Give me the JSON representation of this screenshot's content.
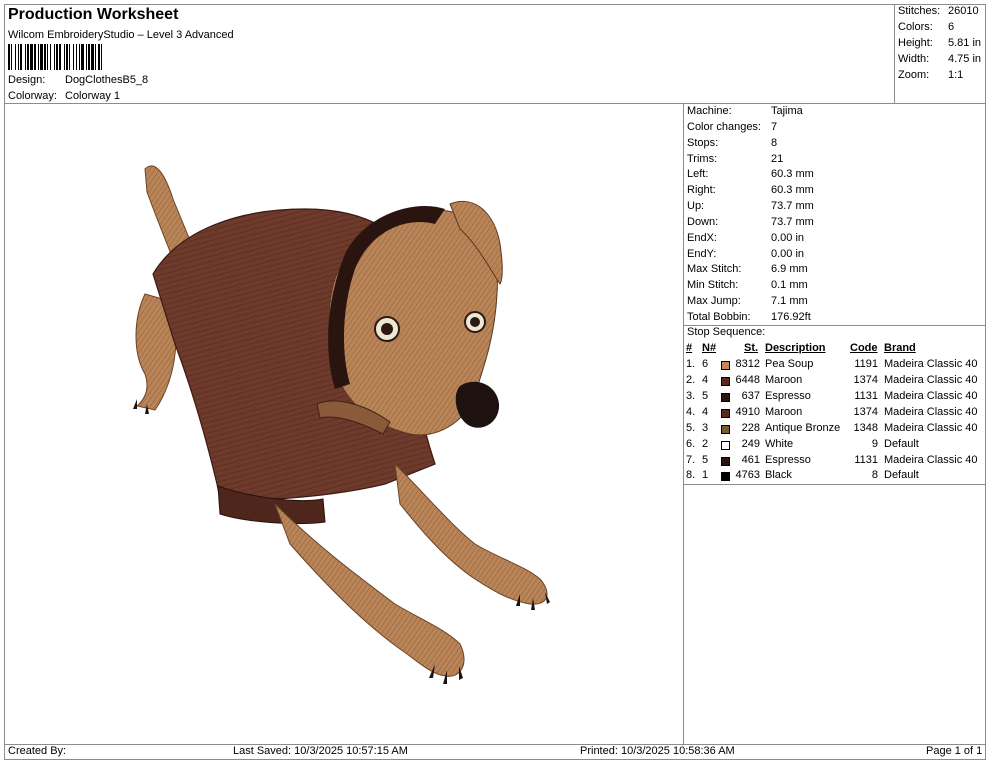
{
  "header": {
    "title": "Production Worksheet",
    "software": "Wilcom EmbroideryStudio – Level 3 Advanced",
    "design_label": "Design:",
    "design_value": "DogClothesB5_8",
    "colorway_label": "Colorway:",
    "colorway_value": "Colorway 1"
  },
  "summary": [
    {
      "label": "Stitches:",
      "value": "26010"
    },
    {
      "label": "Colors:",
      "value": "6"
    },
    {
      "label": "Height:",
      "value": "5.81 in"
    },
    {
      "label": "Width:",
      "value": "4.75 in"
    },
    {
      "label": "Zoom:",
      "value": "1:1"
    }
  ],
  "machine_info": [
    {
      "label": "Machine:",
      "value": "Tajima"
    },
    {
      "label": "Color changes:",
      "value": "7"
    },
    {
      "label": "Stops:",
      "value": "8"
    },
    {
      "label": "Trims:",
      "value": "21"
    },
    {
      "label": "Left:",
      "value": "60.3 mm"
    },
    {
      "label": "Right:",
      "value": "60.3 mm"
    },
    {
      "label": "Up:",
      "value": "73.7 mm"
    },
    {
      "label": "Down:",
      "value": "73.7 mm"
    },
    {
      "label": "EndX:",
      "value": "0.00 in"
    },
    {
      "label": "EndY:",
      "value": "0.00 in"
    },
    {
      "label": "Max Stitch:",
      "value": "6.9 mm"
    },
    {
      "label": "Min Stitch:",
      "value": "0.1 mm"
    },
    {
      "label": "Max Jump:",
      "value": "7.1 mm"
    },
    {
      "label": "Total Bobbin:",
      "value": "176.92ft"
    }
  ],
  "stop_sequence": {
    "title": "Stop Sequence:",
    "columns": {
      "num": "#",
      "n": "N#",
      "st": "St.",
      "desc": "Description",
      "code": "Code",
      "brand": "Brand"
    },
    "rows": [
      {
        "num": "1.",
        "n": "6",
        "color": "#c9855f",
        "st": "8312",
        "desc": "Pea Soup",
        "code": "1191",
        "brand": "Madeira Classic 40"
      },
      {
        "num": "2.",
        "n": "4",
        "color": "#5a2a1e",
        "st": "6448",
        "desc": "Maroon",
        "code": "1374",
        "brand": "Madeira Classic 40"
      },
      {
        "num": "3.",
        "n": "5",
        "color": "#2a1210",
        "st": "637",
        "desc": "Espresso",
        "code": "1131",
        "brand": "Madeira Classic 40"
      },
      {
        "num": "4.",
        "n": "4",
        "color": "#5a2a1e",
        "st": "4910",
        "desc": "Maroon",
        "code": "1374",
        "brand": "Madeira Classic 40"
      },
      {
        "num": "5.",
        "n": "3",
        "color": "#7a5a30",
        "st": "228",
        "desc": "Antique Bronze",
        "code": "1348",
        "brand": "Madeira Classic 40"
      },
      {
        "num": "6.",
        "n": "2",
        "color": "#ffffff",
        "st": "249",
        "desc": "White",
        "code": "9",
        "brand": "Default"
      },
      {
        "num": "7.",
        "n": "5",
        "color": "#2a1210",
        "st": "461",
        "desc": "Espresso",
        "code": "1131",
        "brand": "Madeira Classic 40"
      },
      {
        "num": "8.",
        "n": "1",
        "color": "#000000",
        "st": "4763",
        "desc": "Black",
        "code": "8",
        "brand": "Default"
      }
    ]
  },
  "footer": {
    "created_by": "Created By:",
    "last_saved": "Last Saved: 10/3/2025 10:57:15 AM",
    "printed": "Printed: 10/3/2025 10:58:36 AM",
    "page": "Page 1 of 1"
  }
}
